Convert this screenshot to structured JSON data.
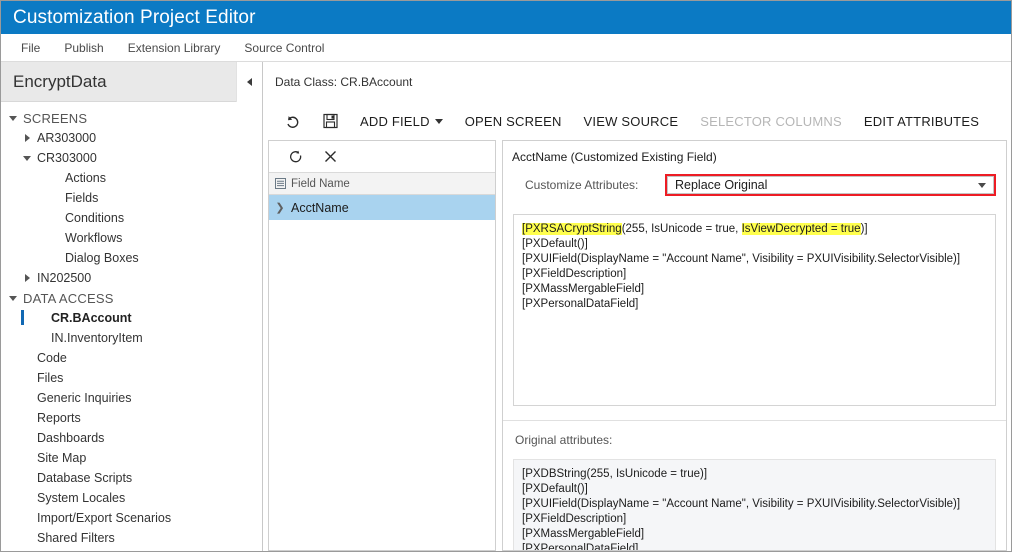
{
  "window": {
    "title": "Customization Project Editor",
    "title_bar_color": "#0b7ac4"
  },
  "menubar": {
    "items": [
      {
        "label": "File"
      },
      {
        "label": "Publish"
      },
      {
        "label": "Extension Library"
      },
      {
        "label": "Source Control"
      }
    ]
  },
  "sidebar": {
    "project_name": "EncryptData",
    "collapse_icon": "chevron-left-icon",
    "items": [
      {
        "label": "SCREENS",
        "indent": 0,
        "caret": "down",
        "group": true,
        "selected": false
      },
      {
        "label": "AR303000",
        "indent": 1,
        "caret": "right",
        "group": false,
        "selected": false
      },
      {
        "label": "CR303000",
        "indent": 1,
        "caret": "down",
        "group": false,
        "selected": false
      },
      {
        "label": "Actions",
        "indent": 3,
        "caret": "none",
        "group": false,
        "selected": false
      },
      {
        "label": "Fields",
        "indent": 3,
        "caret": "none",
        "group": false,
        "selected": false
      },
      {
        "label": "Conditions",
        "indent": 3,
        "caret": "none",
        "group": false,
        "selected": false
      },
      {
        "label": "Workflows",
        "indent": 3,
        "caret": "none",
        "group": false,
        "selected": false
      },
      {
        "label": "Dialog Boxes",
        "indent": 3,
        "caret": "none",
        "group": false,
        "selected": false
      },
      {
        "label": "IN202500",
        "indent": 1,
        "caret": "right",
        "group": false,
        "selected": false
      },
      {
        "label": "DATA ACCESS",
        "indent": 0,
        "caret": "down",
        "group": true,
        "selected": false
      },
      {
        "label": "CR.BAccount",
        "indent": 2,
        "caret": "none",
        "group": false,
        "selected": true
      },
      {
        "label": "IN.InventoryItem",
        "indent": 2,
        "caret": "none",
        "group": false,
        "selected": false
      },
      {
        "label": "Code",
        "indent": 1,
        "caret": "none",
        "group": false,
        "selected": false
      },
      {
        "label": "Files",
        "indent": 1,
        "caret": "none",
        "group": false,
        "selected": false
      },
      {
        "label": "Generic Inquiries",
        "indent": 1,
        "caret": "none",
        "group": false,
        "selected": false
      },
      {
        "label": "Reports",
        "indent": 1,
        "caret": "none",
        "group": false,
        "selected": false
      },
      {
        "label": "Dashboards",
        "indent": 1,
        "caret": "none",
        "group": false,
        "selected": false
      },
      {
        "label": "Site Map",
        "indent": 1,
        "caret": "none",
        "group": false,
        "selected": false
      },
      {
        "label": "Database Scripts",
        "indent": 1,
        "caret": "none",
        "group": false,
        "selected": false
      },
      {
        "label": "System Locales",
        "indent": 1,
        "caret": "none",
        "group": false,
        "selected": false
      },
      {
        "label": "Import/Export Scenarios",
        "indent": 1,
        "caret": "none",
        "group": false,
        "selected": false
      },
      {
        "label": "Shared Filters",
        "indent": 1,
        "caret": "none",
        "group": false,
        "selected": false
      }
    ]
  },
  "main": {
    "data_class_label": "Data Class: CR.BAccount",
    "toolbar": {
      "undo_icon": "undo-icon",
      "save_icon": "save-disk-icon",
      "add_field_label": "ADD FIELD",
      "open_screen_label": "OPEN SCREEN",
      "view_source_label": "VIEW SOURCE",
      "selector_columns_label": "SELECTOR COLUMNS",
      "selector_columns_disabled": true,
      "edit_attributes_label": "EDIT ATTRIBUTES"
    },
    "field_list": {
      "refresh_icon": "refresh-icon",
      "delete_icon": "close-x-icon",
      "column_header": "Field Name",
      "rows": [
        {
          "name": "AcctName",
          "selected": true
        }
      ]
    },
    "details": {
      "header": "AcctName (Customized Existing Field)",
      "customize_label": "Customize Attributes:",
      "customize_value": "Replace Original",
      "customize_highlight_color": "#ed1c24",
      "attributes": [
        {
          "pre": "[",
          "hl1": "PXRSACryptString",
          "mid": "(255, IsUnicode = true, ",
          "hl2": "IsViewDecrypted = true",
          "post": ")]"
        },
        {
          "plain": "[PXDefault()]"
        },
        {
          "plain": "[PXUIField(DisplayName = \"Account Name\", Visibility = PXUIVisibility.SelectorVisible)]"
        },
        {
          "plain": "[PXFieldDescription]"
        },
        {
          "plain": "[PXMassMergableField]"
        },
        {
          "plain": "[PXPersonalDataField]"
        }
      ],
      "original_label": "Original attributes:",
      "original_attributes": [
        "[PXDBString(255, IsUnicode = true)]",
        "[PXDefault()]",
        "[PXUIField(DisplayName = \"Account Name\", Visibility = PXUIVisibility.SelectorVisible)]",
        "[PXFieldDescription]",
        "[PXMassMergableField]",
        "[PXPersonalDataField]"
      ],
      "highlight_color": "#ffff4d"
    }
  }
}
